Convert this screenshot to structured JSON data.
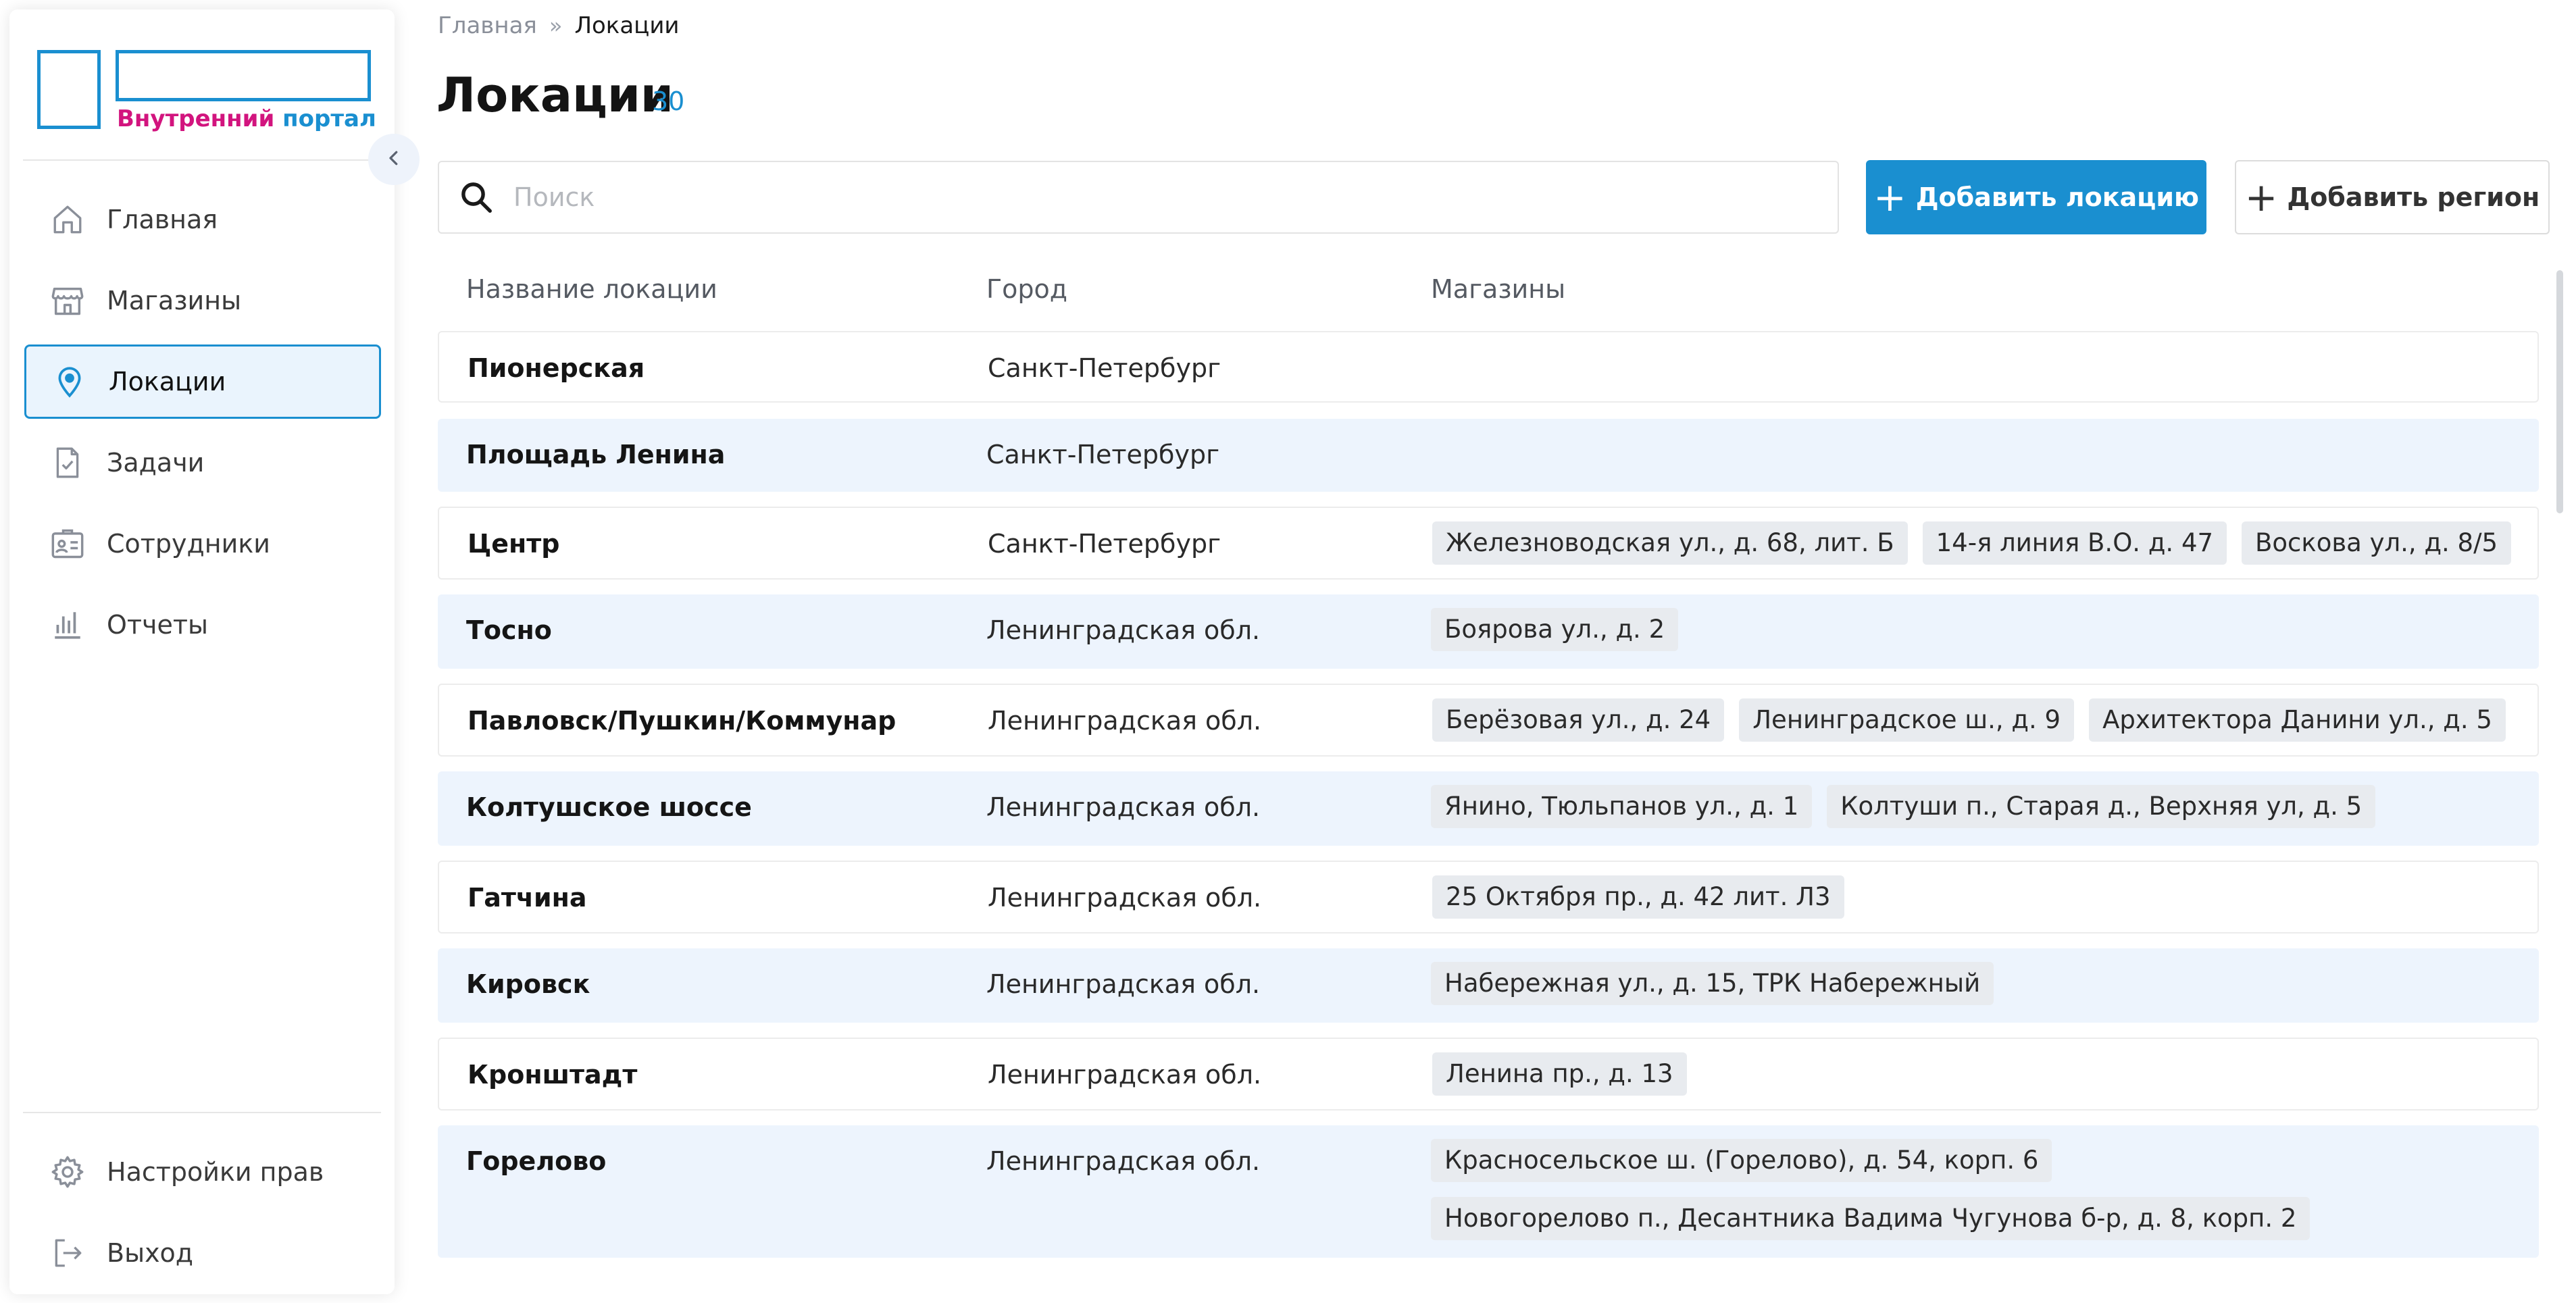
{
  "logo": {
    "word1": "Внутренний",
    "word2": "портал"
  },
  "nav": {
    "items": [
      {
        "label": "Главная",
        "icon": "home-icon",
        "active": false
      },
      {
        "label": "Магазины",
        "icon": "store-icon",
        "active": false
      },
      {
        "label": "Локации",
        "icon": "location-pin-icon",
        "active": true
      },
      {
        "label": "Задачи",
        "icon": "task-document-icon",
        "active": false
      },
      {
        "label": "Сотрудники",
        "icon": "id-card-icon",
        "active": false
      },
      {
        "label": "Отчеты",
        "icon": "bar-chart-icon",
        "active": false
      }
    ],
    "bottom": [
      {
        "label": "Настройки прав",
        "icon": "gear-icon"
      },
      {
        "label": "Выход",
        "icon": "logout-icon"
      }
    ]
  },
  "breadcrumb": {
    "home": "Главная",
    "separator": "»",
    "current": "Локации"
  },
  "page": {
    "title": "Локации",
    "count": "30"
  },
  "search": {
    "placeholder": "Поиск"
  },
  "actions": {
    "add_location": "Добавить локацию",
    "add_region": "Добавить регион"
  },
  "table": {
    "headers": {
      "name": "Название локации",
      "city": "Город",
      "shops": "Магазины"
    },
    "rows": [
      {
        "name": "Пионерская",
        "city": "Санкт-Петербург",
        "shops": []
      },
      {
        "name": "Площадь Ленина",
        "city": "Санкт-Петербург",
        "shops": []
      },
      {
        "name": "Центр",
        "city": "Санкт-Петербург",
        "shops": [
          "Железноводская ул., д. 68, лит. Б",
          "14-я линия В.О. д. 47",
          "Воскова ул., д. 8/5"
        ]
      },
      {
        "name": "Тосно",
        "city": "Ленинградская обл.",
        "shops": [
          "Боярова ул., д. 2"
        ]
      },
      {
        "name": "Павловск/Пушкин/Коммунар",
        "city": "Ленинградская обл.",
        "shops": [
          "Берёзовая ул., д. 24",
          "Ленинградское ш., д. 9",
          "Архитектора Данини ул., д. 5"
        ]
      },
      {
        "name": "Колтушское шоссе",
        "city": "Ленинградская обл.",
        "shops": [
          "Янино, Тюльпанов ул., д. 1",
          "Колтуши п., Старая д., Верхняя ул, д. 5"
        ]
      },
      {
        "name": "Гатчина",
        "city": "Ленинградская обл.",
        "shops": [
          "25 Октября пр., д. 42 лит. Л3"
        ]
      },
      {
        "name": "Кировск",
        "city": "Ленинградская обл.",
        "shops": [
          "Набережная ул., д. 15, ТРК Набережный"
        ]
      },
      {
        "name": "Кронштадт",
        "city": "Ленинградская обл.",
        "shops": [
          "Ленина пр., д. 13"
        ]
      },
      {
        "name": "Горелово",
        "city": "Ленинградская обл.",
        "shops": [
          "Красносельское ш. (Горелово), д. 54, корп. 6",
          "Новогорелово п., Десантника Вадима Чугунова б-р, д. 8, корп. 2"
        ]
      }
    ]
  },
  "colors": {
    "accent": "#1a8fd0",
    "brand_pink": "#d2147e",
    "row_alt": "#edf4fd",
    "chip": "#e8ebef"
  }
}
